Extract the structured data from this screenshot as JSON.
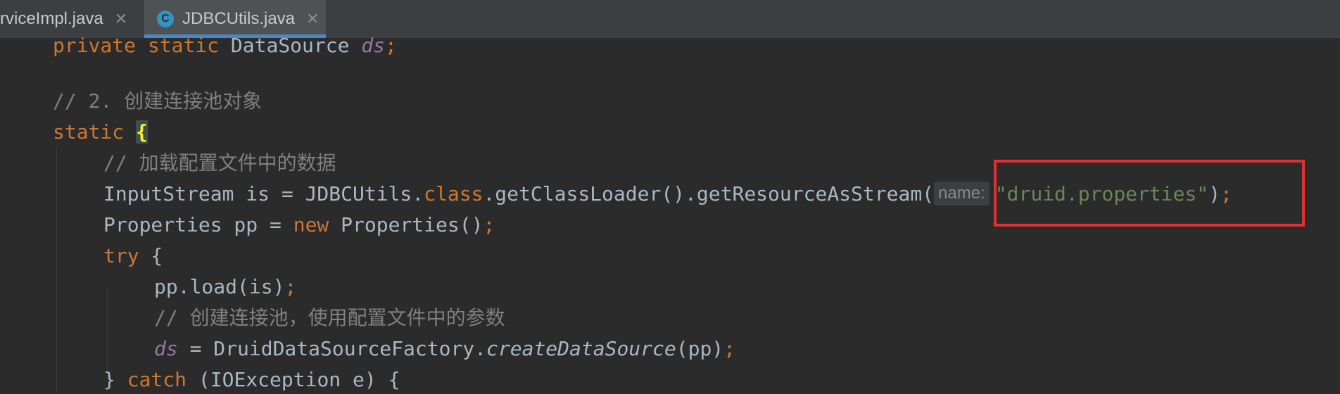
{
  "tabs": [
    {
      "label": "rviceImpl.java",
      "close": "✕"
    },
    {
      "label": "JDBCUtils.java",
      "icon": "C",
      "close": "✕",
      "active": true
    }
  ],
  "code": {
    "line1": {
      "kw1": "private",
      "kw2": "static",
      "type": "DataSource",
      "field": "ds",
      "semi": ";"
    },
    "line2_comment": "// 2. 创建连接池对象",
    "line3": {
      "kw": "static",
      "brace": "{"
    },
    "line4_comment": "// 加载配置文件中的数据",
    "line5": {
      "pre": "InputStream is = JDBCUtils.",
      "kw": "class",
      "mid": ".getClassLoader().getResourceAsStream(",
      "hint": "name:",
      "string": "\"druid.properties\"",
      "close": ")",
      "semi": ";"
    },
    "line6": {
      "pre": "Properties pp = ",
      "kw": "new",
      "post": " Properties()",
      "semi": ";"
    },
    "line7": {
      "kw": "try",
      "post": " {"
    },
    "line8": {
      "text": "pp.load(is)",
      "semi": ";"
    },
    "line9_comment": "// 创建连接池，使用配置文件中的参数",
    "line10": {
      "field": "ds",
      "mid": " = DruidDataSourceFactory.",
      "method": "createDataSource",
      "args": "(pp)",
      "semi": ";"
    },
    "line11": {
      "pre": "} ",
      "kw": "catch",
      "post": " (IOException e) {"
    }
  },
  "colors": {
    "background": "#2b2b2b",
    "keyword": "#cc7832",
    "comment": "#808080",
    "string": "#6a8759",
    "field": "#9876aa",
    "highlight_box": "#e03131"
  }
}
